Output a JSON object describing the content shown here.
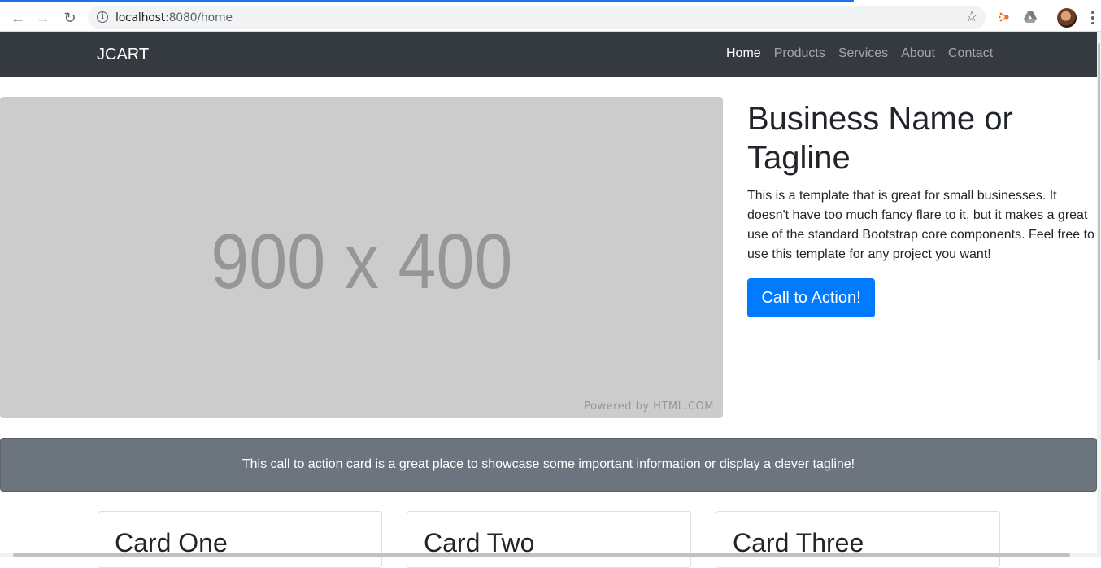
{
  "browser": {
    "url_host": "localhost",
    "url_rest": ":8080/home",
    "back_icon": "←",
    "forward_icon": "→",
    "reload_icon": "↻",
    "star_icon": "☆"
  },
  "navbar": {
    "brand": "JCART",
    "links": [
      "Home",
      "Products",
      "Services",
      "About",
      "Contact"
    ],
    "active": "Home"
  },
  "hero": {
    "placeholder_text": "900 x 400",
    "powered_by": "Powered by HTML.COM",
    "headline": "Business Name or Tagline",
    "lead": "This is a template that is great for small businesses. It doesn't have too much fancy flare to it, but it makes a great use of the standard Bootstrap core components. Feel free to use this template for any project you want!",
    "cta_label": "Call to Action!"
  },
  "cta_card": {
    "text": "This call to action card is a great place to showcase some important information or display a clever tagline!"
  },
  "cards": [
    {
      "title": "Card One"
    },
    {
      "title": "Card Two"
    },
    {
      "title": "Card Three"
    }
  ],
  "colors": {
    "navbar_bg": "#343a40",
    "primary": "#007bff",
    "cta_card_bg": "#6c757d",
    "placeholder_bg": "#cccccc"
  }
}
